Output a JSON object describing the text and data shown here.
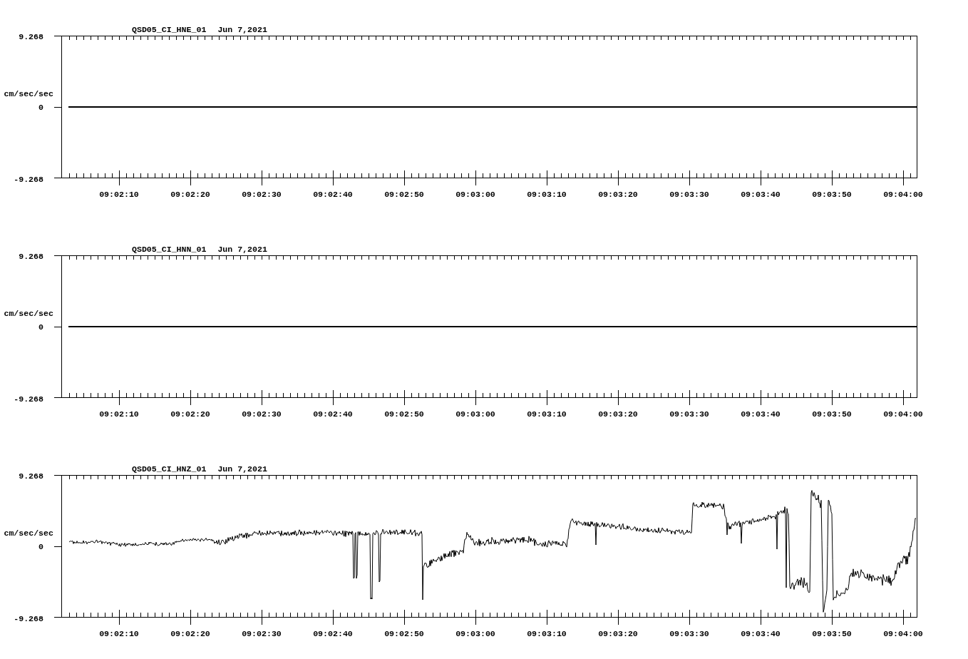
{
  "panels": [
    {
      "title": {
        "station": "QSD05_CI_HNE_01",
        "date": "Jun 7,2021"
      },
      "y_axis": {
        "max": "9.268",
        "unit": "cm/sec/sec",
        "zero": "0",
        "min": "-9.268"
      },
      "x_axis": {
        "ticks": [
          "09:02:10",
          "09:02:20",
          "09:02:30",
          "09:02:40",
          "09:02:50",
          "09:03:00",
          "09:03:10",
          "09:03:20",
          "09:03:30",
          "09:03:40",
          "09:03:50",
          "09:04:00"
        ]
      },
      "trace": {
        "kind": "flat"
      }
    },
    {
      "title": {
        "station": "QSD05_CI_HNN_01",
        "date": "Jun 7,2021"
      },
      "y_axis": {
        "max": "9.268",
        "unit": "cm/sec/sec",
        "zero": "0",
        "min": "-9.268"
      },
      "x_axis": {
        "ticks": [
          "09:02:10",
          "09:02:20",
          "09:02:30",
          "09:02:40",
          "09:02:50",
          "09:03:00",
          "09:03:10",
          "09:03:20",
          "09:03:30",
          "09:03:40",
          "09:03:50",
          "09:04:00"
        ]
      },
      "trace": {
        "kind": "flat"
      }
    },
    {
      "title": {
        "station": "QSD05_CI_HNZ_01",
        "date": "Jun 7,2021"
      },
      "y_axis": {
        "max": "9.268",
        "unit": "cm/sec/sec",
        "zero": "0",
        "min": "-9.268"
      },
      "x_axis": {
        "ticks": [
          "09:02:10",
          "09:02:20",
          "09:02:30",
          "09:02:40",
          "09:02:50",
          "09:03:00",
          "09:03:10",
          "09:03:20",
          "09:03:30",
          "09:03:40",
          "09:03:50",
          "09:04:00"
        ]
      },
      "trace": {
        "kind": "waveform"
      }
    }
  ]
}
